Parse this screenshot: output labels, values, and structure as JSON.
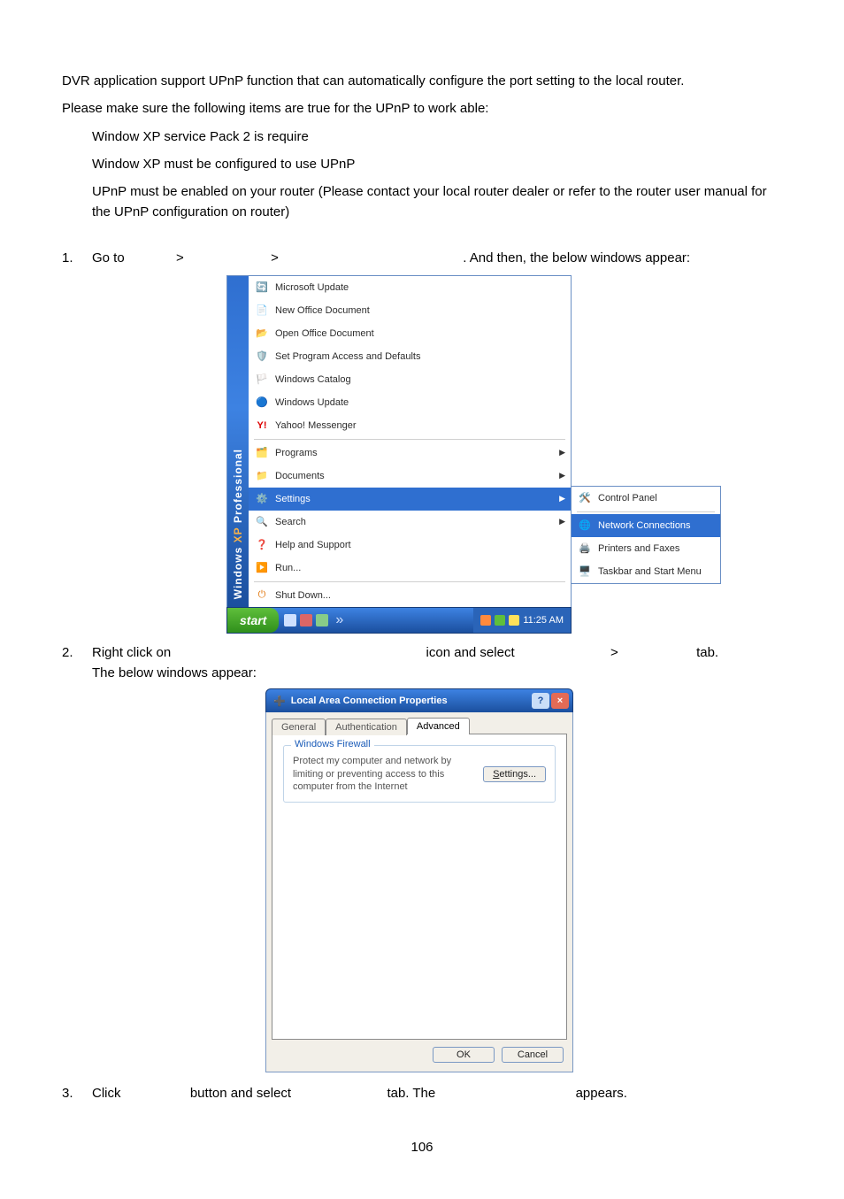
{
  "intro_p1": "DVR application support UPnP function that can automatically configure the port setting to the local router.",
  "intro_p2": "Please make sure the following items are true for the UPnP to work able:",
  "bullets": {
    "b1": "Window XP service Pack 2 is require",
    "b2": "Window XP must be configured to use UPnP",
    "b3": "UPnP must be enabled on your router (Please contact your local router dealer or refer to the router user manual for the UPnP configuration on router)"
  },
  "steps": {
    "n1": "1.",
    "s1a": "Go to",
    "s1b": ">",
    "s1c": ">",
    "s1d": ". And then, the below windows appear:",
    "n2": "2.",
    "s2a": "Right click on",
    "s2b": "icon and select",
    "s2c": ">",
    "s2d": "tab.",
    "s2e": "The below windows appear:",
    "n3": "3.",
    "s3a": "Click",
    "s3b": "button and select",
    "s3c": "tab. The",
    "s3d": "appears."
  },
  "startmenu": {
    "rail": {
      "win": "Windows",
      "xp": "XP",
      "suffix": " Professional"
    },
    "items_top": [
      "Microsoft Update",
      "New Office Document",
      "Open Office Document",
      "Set Program Access and Defaults",
      "Windows Catalog",
      "Windows Update",
      "Yahoo! Messenger"
    ],
    "programs": "Programs",
    "documents": "Documents",
    "settings": "Settings",
    "search": "Search",
    "help": "Help and Support",
    "run": "Run...",
    "shutdown": "Shut Down...",
    "submenu": {
      "cp": "Control Panel",
      "nc": "Network Connections",
      "pf": "Printers and Faxes",
      "tsm": "Taskbar and Start Menu"
    },
    "taskbar": {
      "start": "start",
      "time": "11:25 AM"
    }
  },
  "dialog": {
    "title": "Local Area Connection Properties",
    "help": "?",
    "close": "×",
    "tabs": {
      "general": "General",
      "auth": "Authentication",
      "adv": "Advanced"
    },
    "fieldset_legend": "Windows Firewall",
    "fieldset_desc": "Protect my computer and network by limiting or preventing access to this computer from the Internet",
    "settings_btn": "Settings...",
    "ok": "OK",
    "cancel": "Cancel"
  },
  "page_num": "106"
}
